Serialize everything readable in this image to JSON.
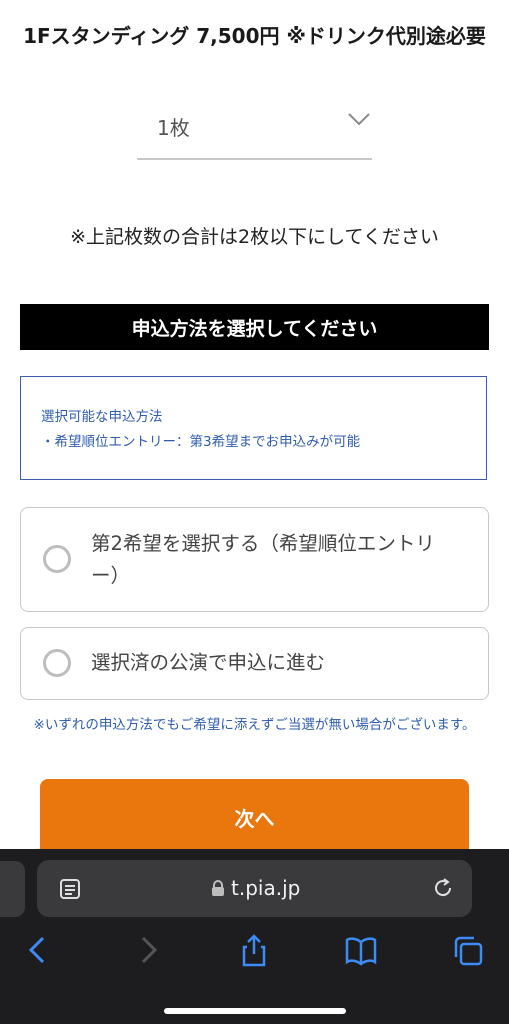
{
  "ticket": {
    "title": "1Fスタンディング 7,500円 ※ドリンク代別途必要",
    "quantity": "1枚"
  },
  "limit_note": "※上記枚数の合計は2枚以下にしてください",
  "section": {
    "title": "申込方法を選択してください"
  },
  "info": {
    "line1": "選択可能な申込方法",
    "line2": "・希望順位エントリー：第3希望までお申込みが可能"
  },
  "options": [
    {
      "label": "第2希望を選択する（希望順位エントリー）"
    },
    {
      "label": "選択済の公演で申込に進む"
    }
  ],
  "disclaimer": "※いずれの申込方法でもご希望に添えずご当選が無い場合がございます。",
  "next_button": "次へ",
  "browser": {
    "url": "t.pia.jp"
  },
  "colors": {
    "accent": "#ea770e",
    "info_blue": "#2e5dad",
    "header_bg": "#000000",
    "toolbar_icon": "#3d8cf5"
  }
}
